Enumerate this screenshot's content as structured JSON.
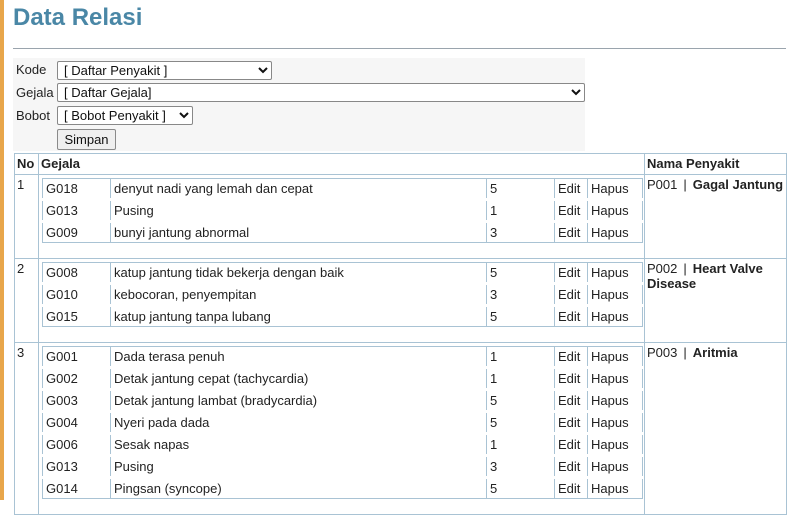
{
  "page": {
    "title": "Data Relasi"
  },
  "form": {
    "kode_label": "Kode",
    "kode_select": "[ Daftar Penyakit ]",
    "gejala_label": "Gejala",
    "gejala_select": "[ Daftar Gejala]",
    "bobot_label": "Bobot",
    "bobot_select": "[ Bobot Penyakit ]",
    "simpan_label": "Simpan"
  },
  "table": {
    "headers": {
      "no": "No",
      "gejala": "Gejala",
      "penyakit": "Nama Penyakit"
    },
    "edit_label": "Edit",
    "hapus_label": "Hapus",
    "separator": "|",
    "rows": [
      {
        "no": "1",
        "kode": "P001",
        "nama": "Gagal Jantung",
        "gejala": [
          {
            "kode": "G018",
            "nama": "denyut nadi yang lemah dan cepat",
            "bobot": "5"
          },
          {
            "kode": "G013",
            "nama": "Pusing",
            "bobot": "1"
          },
          {
            "kode": "G009",
            "nama": "bunyi jantung abnormal",
            "bobot": "3"
          }
        ]
      },
      {
        "no": "2",
        "kode": "P002",
        "nama": "Heart Valve Disease",
        "gejala": [
          {
            "kode": "G008",
            "nama": "katup jantung tidak bekerja dengan baik",
            "bobot": "5"
          },
          {
            "kode": "G010",
            "nama": "kebocoran, penyempitan",
            "bobot": "3"
          },
          {
            "kode": "G015",
            "nama": "katup jantung tanpa lubang",
            "bobot": "5"
          }
        ]
      },
      {
        "no": "3",
        "kode": "P003",
        "nama": "Aritmia",
        "gejala": [
          {
            "kode": "G001",
            "nama": "Dada terasa penuh",
            "bobot": "1"
          },
          {
            "kode": "G002",
            "nama": "Detak jantung cepat (tachycardia)",
            "bobot": "1"
          },
          {
            "kode": "G003",
            "nama": "Detak jantung lambat (bradycardia)",
            "bobot": "5"
          },
          {
            "kode": "G004",
            "nama": "Nyeri pada dada",
            "bobot": "5"
          },
          {
            "kode": "G006",
            "nama": "Sesak napas",
            "bobot": "1"
          },
          {
            "kode": "G013",
            "nama": "Pusing",
            "bobot": "3"
          },
          {
            "kode": "G014",
            "nama": "Pingsan (syncope)",
            "bobot": "5"
          }
        ]
      }
    ]
  }
}
